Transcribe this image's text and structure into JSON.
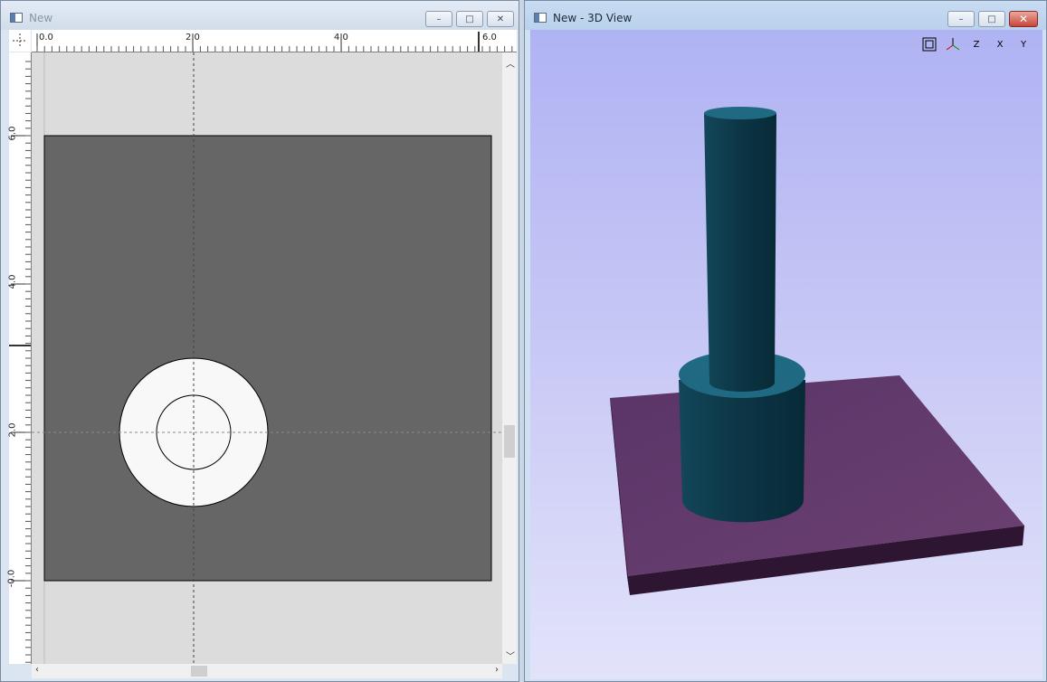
{
  "left_window": {
    "title": "New",
    "ruler_x_labels": [
      "0.0",
      "2.0",
      "4.0",
      "6.0"
    ],
    "ruler_y_labels": [
      "6.0",
      "4.0",
      "2.0",
      "-0.0"
    ]
  },
  "right_window": {
    "title": "New - 3D View",
    "view_tools": [
      {
        "name": "zoom-extents-icon",
        "label": ""
      },
      {
        "name": "isometric-axes-icon",
        "label": ""
      },
      {
        "name": "view-z-icon",
        "label": "Z"
      },
      {
        "name": "view-x-icon",
        "label": "X"
      },
      {
        "name": "view-y-icon",
        "label": "Y"
      }
    ]
  },
  "window_controls": {
    "minimize": "–",
    "maximize": "□",
    "close": "✕"
  },
  "colors": {
    "plate_top": "#623c6c",
    "plate_side": "#2e1633",
    "cylinder": "#0d3a4a",
    "cylinder_top": "#1f6a82",
    "sketch_fill": "#666666",
    "boss_fill": "#f8f8f8"
  }
}
